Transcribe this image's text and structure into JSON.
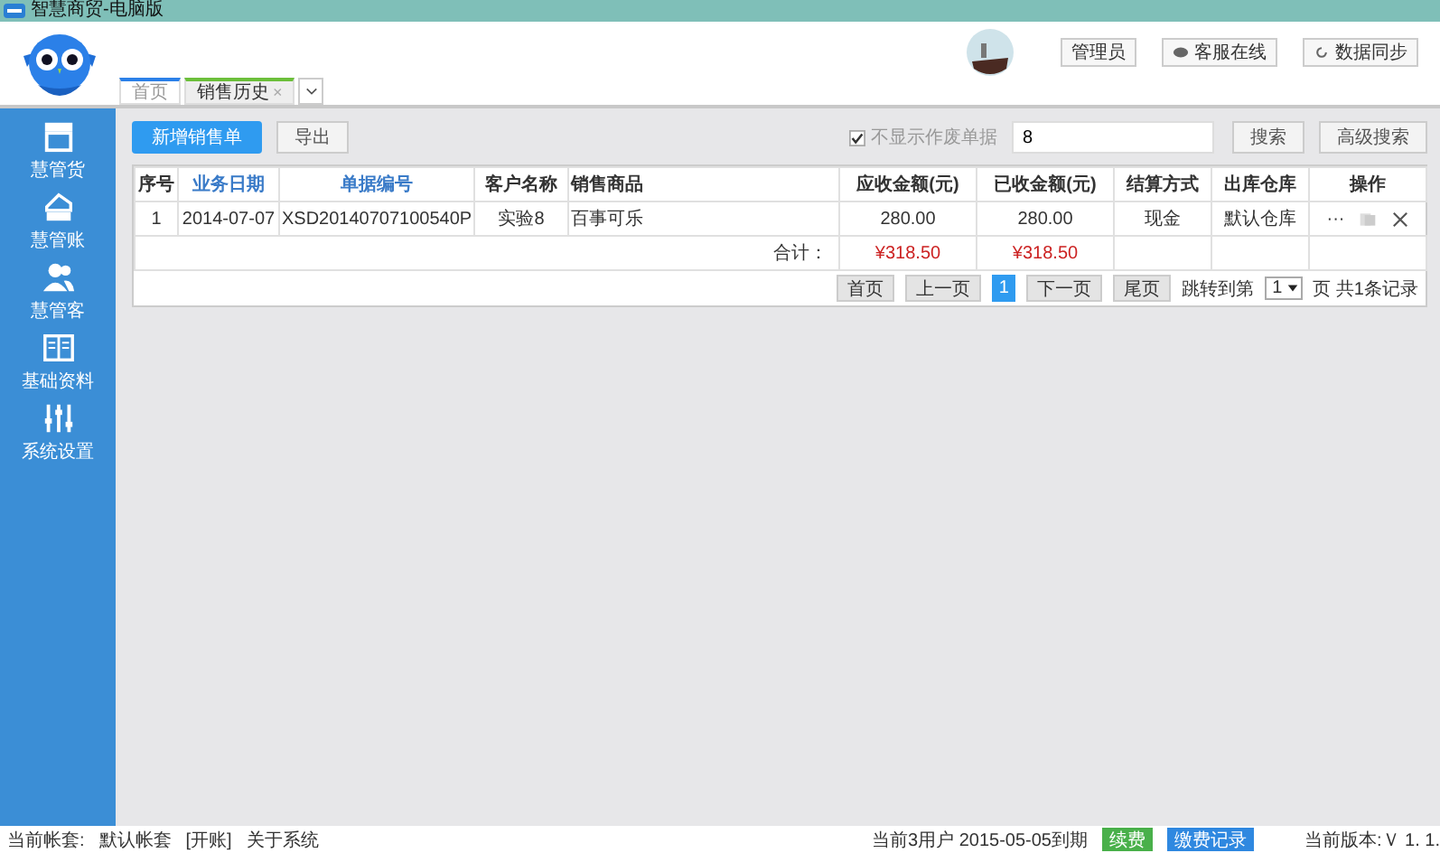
{
  "window": {
    "title": "智慧商贸-电脑版"
  },
  "header": {
    "buttons": [
      {
        "label": "管理员",
        "kind": "plain"
      },
      {
        "label": "客服在线",
        "kind": "chat"
      },
      {
        "label": "数据同步",
        "kind": "sync"
      }
    ]
  },
  "tabs": [
    {
      "label": "首页",
      "selected": false
    },
    {
      "label": "销售历史",
      "selected": true,
      "close": "×"
    }
  ],
  "sidebar": {
    "items": [
      {
        "label": "慧管货",
        "kind": "store"
      },
      {
        "label": "慧管账",
        "kind": "tray"
      },
      {
        "label": "慧管客",
        "kind": "people"
      },
      {
        "label": "基础资料",
        "kind": "book"
      },
      {
        "label": "系统设置",
        "kind": "sliders"
      }
    ]
  },
  "toolbar": {
    "new_button": "新增销售单",
    "export_button": "导出",
    "hide_void": {
      "label": "不显示作废单据",
      "checked": true
    },
    "search": {
      "value": "8"
    },
    "search_button": "搜索",
    "advanced_button": "高级搜索"
  },
  "table": {
    "columns": [
      {
        "label": "序号",
        "link": false
      },
      {
        "label": "业务日期",
        "link": true
      },
      {
        "label": "单据编号",
        "link": true
      },
      {
        "label": "客户名称",
        "link": false
      },
      {
        "label": "销售商品",
        "link": false
      },
      {
        "label": "应收金额(元)",
        "link": false
      },
      {
        "label": "已收金额(元)",
        "link": false
      },
      {
        "label": "结算方式",
        "link": false
      },
      {
        "label": "出库仓库",
        "link": false
      },
      {
        "label": "操作",
        "link": false
      }
    ],
    "rows": [
      {
        "cells": [
          "1",
          "2014-07-07",
          "XSD20140707100540P",
          "实验8",
          "百事可乐",
          "280.00",
          "280.00",
          "现金",
          "默认仓库"
        ],
        "more": "···"
      }
    ],
    "total": {
      "label": "合计：",
      "receivable": "¥318.50",
      "received": "¥318.50"
    }
  },
  "pagination": {
    "first": "首页",
    "prev": "上一页",
    "pages": [
      {
        "label": "1",
        "selected": true
      }
    ],
    "next": "下一页",
    "last": "尾页",
    "jump_label": "跳转到第",
    "jump_value": "1",
    "suffix": "页 共1条记录"
  },
  "status_bar": {
    "account_label": "当前帐套:",
    "account": "默认帐套",
    "open_account": "[开账]",
    "about": "关于系统",
    "users": "当前3用户 2015-05-05到期",
    "renew": "续费",
    "payments": "缴费记录",
    "version": "当前版本:Ｖ 1. 1."
  }
}
